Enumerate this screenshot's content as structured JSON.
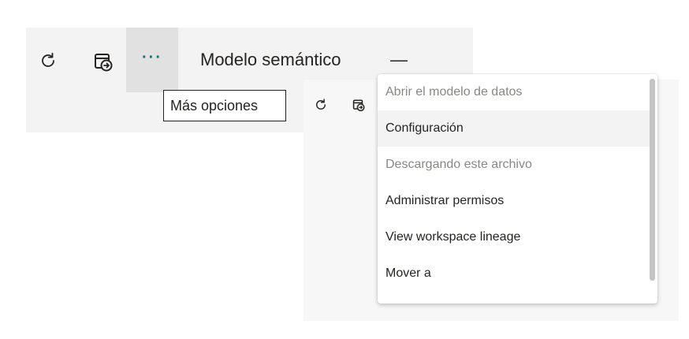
{
  "toolbar": {
    "icons": [
      "refresh-icon",
      "scheduled-refresh-icon",
      "more-options-icon"
    ],
    "more_options_glyph": "···",
    "title": "Modelo semántico",
    "collapse_glyph": "—"
  },
  "tooltip": {
    "label": "Más opciones"
  },
  "menu": {
    "items": [
      {
        "label": "Abrir el modelo de datos",
        "state": "disabled"
      },
      {
        "label": "Configuración",
        "state": "hovered"
      },
      {
        "label": "Descargando este archivo",
        "state": "disabled"
      },
      {
        "label": "Administrar permisos",
        "state": "enabled"
      },
      {
        "label": "View workspace lineage",
        "state": "enabled"
      },
      {
        "label": "Mover a",
        "state": "enabled"
      }
    ]
  },
  "colors": {
    "toolbar_bg": "#f3f3f3",
    "more_button_bg": "#e1e1e1",
    "accent": "#117865",
    "text": "#252423",
    "disabled_text": "#8a8886"
  }
}
